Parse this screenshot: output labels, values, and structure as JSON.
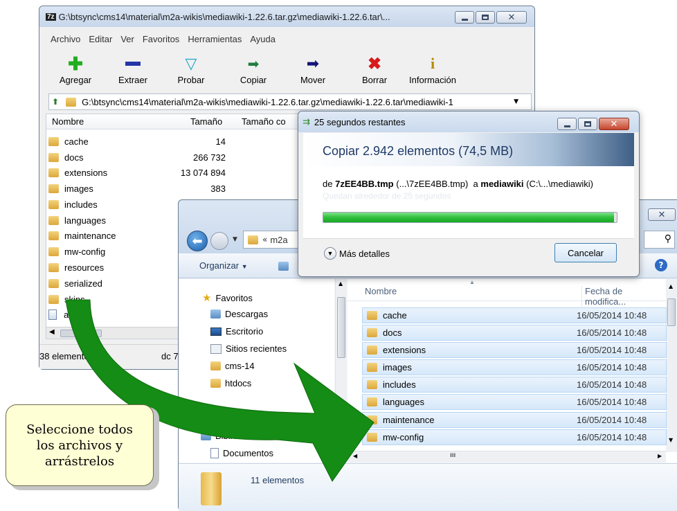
{
  "sevenzip": {
    "app_icon": "7z",
    "title": "G:\\btsync\\cms14\\material\\m2a-wikis\\mediawiki-1.22.6.tar.gz\\mediawiki-1.22.6.tar\\...",
    "menu": [
      "Archivo",
      "Editar",
      "Ver",
      "Favoritos",
      "Herramientas",
      "Ayuda"
    ],
    "toolbar": [
      "Agregar",
      "Extraer",
      "Probar",
      "Copiar",
      "Mover",
      "Borrar",
      "Información"
    ],
    "address": "G:\\btsync\\cms14\\material\\m2a-wikis\\mediawiki-1.22.6.tar.gz\\mediawiki-1.22.6.tar\\mediawiki-1",
    "columns": {
      "name": "Nombre",
      "size": "Tamaño",
      "packed": "Tamaño co"
    },
    "rows": [
      {
        "name": "cache",
        "size": "14"
      },
      {
        "name": "docs",
        "size": "266 732"
      },
      {
        "name": "extensions",
        "size": "13 074 894"
      },
      {
        "name": "images",
        "size": "383"
      },
      {
        "name": "includes",
        "size": ""
      },
      {
        "name": "languages",
        "size": ""
      },
      {
        "name": "maintenance",
        "size": ""
      },
      {
        "name": "mw-config",
        "size": ""
      },
      {
        "name": "resources",
        "size": ""
      },
      {
        "name": "serialized",
        "size": ""
      },
      {
        "name": "skins",
        "size": ""
      },
      {
        "name": "api.ph",
        "size": ""
      }
    ],
    "status": "38 elemento(s)",
    "status_right": "dc 7"
  },
  "copy_dialog": {
    "title": "25 segundos restantes",
    "heading": "Copiar 2.942 elementos (74,5 MB)",
    "from_label": "de",
    "from_file": "7zEE4BB.tmp",
    "from_path": "(...\\7zEE4BB.tmp)",
    "to_label": "a",
    "to_dir": "mediawiki",
    "to_path": "(C:\\...\\mediawiki)",
    "remaining": "Quedan alrededor de 25 segundos",
    "progress": 0.99,
    "details": "Más detalles",
    "cancel": "Cancelar"
  },
  "explorer": {
    "breadcrumb": "m2a",
    "organize": "Organizar",
    "nav": {
      "favorites": "Favoritos",
      "items": [
        "Descargas",
        "Escritorio",
        "Sitios recientes",
        "cms-14",
        "htdocs"
      ],
      "libraries": "Bibliotecas",
      "lib_items": [
        "Documentos"
      ]
    },
    "columns": {
      "name": "Nombre",
      "date": "Fecha de modifica..."
    },
    "files": [
      {
        "name": "cache",
        "date": "16/05/2014 10:48"
      },
      {
        "name": "docs",
        "date": "16/05/2014 10:48"
      },
      {
        "name": "extensions",
        "date": "16/05/2014 10:48"
      },
      {
        "name": "images",
        "date": "16/05/2014 10:48"
      },
      {
        "name": "includes",
        "date": "16/05/2014 10:48"
      },
      {
        "name": "languages",
        "date": "16/05/2014 10:48"
      },
      {
        "name": "maintenance",
        "date": "16/05/2014 10:48"
      },
      {
        "name": "mw-config",
        "date": "16/05/2014 10:48"
      }
    ],
    "count": "11 elementos"
  },
  "note": "Seleccione todos los archivos y arrástrelos",
  "colors": {
    "arrow": "#158c15",
    "progress": "#2fbf3b",
    "note_bg": "#ffffd6",
    "selection": "#dcebfb"
  }
}
